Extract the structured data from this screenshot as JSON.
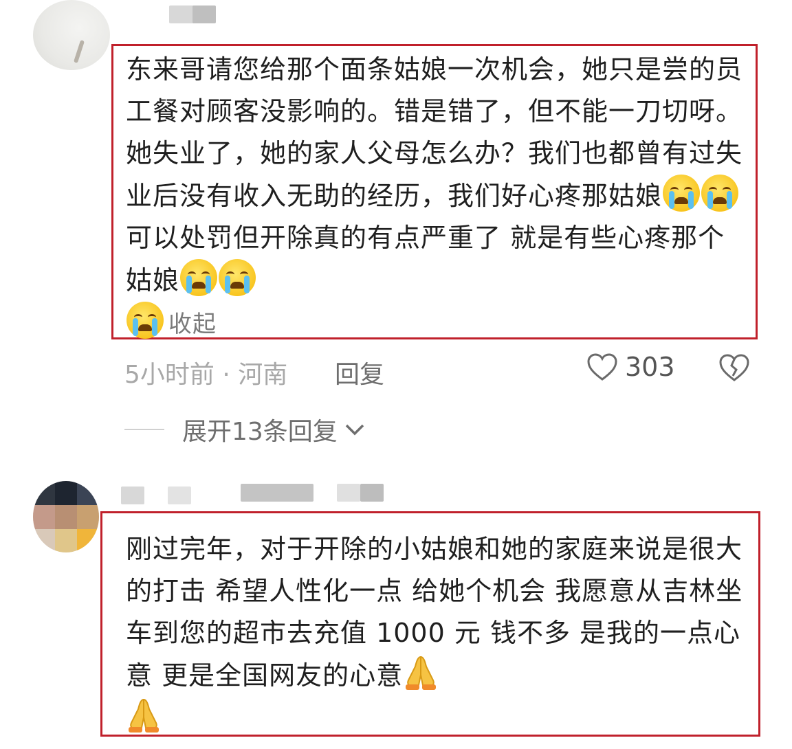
{
  "comment1": {
    "text_parts": [
      "东来哥请您给那个面条姑娘一次机会，她只是尝的员工餐对顾客没影响的。错是错了，但不能一刀切呀。她失业了，她的家人父母怎么办？我们也都曾有过失业后没有收入无助的经历，我们好心疼那姑娘",
      "可以处罚但开除真的有点严重了 就是有些心疼那个姑娘"
    ],
    "collapse_label": "收起",
    "time_location": "5小时前 · 河南",
    "reply_label": "回复",
    "like_count": "303",
    "expand_label": "展开13条回复",
    "icons": [
      "crying-face-emoji",
      "loudly-crying-face-emoji",
      "heart-icon",
      "broken-heart-icon",
      "chevron-down-icon"
    ]
  },
  "comment2": {
    "text": "刚过完年，对于开除的小姑娘和她的家庭来说是很大的打击 希望人性化一点 给她个机会 我愿意从吉林坐车到您的超市去充值 1000 元 钱不多 是我的一点心意 更是全国网友的心意",
    "icons": [
      "folded-hands-emoji"
    ]
  },
  "colors": {
    "highlight_border": "#c0202b",
    "meta_gray": "#a8a8a8",
    "text": "#1f1f1f"
  }
}
